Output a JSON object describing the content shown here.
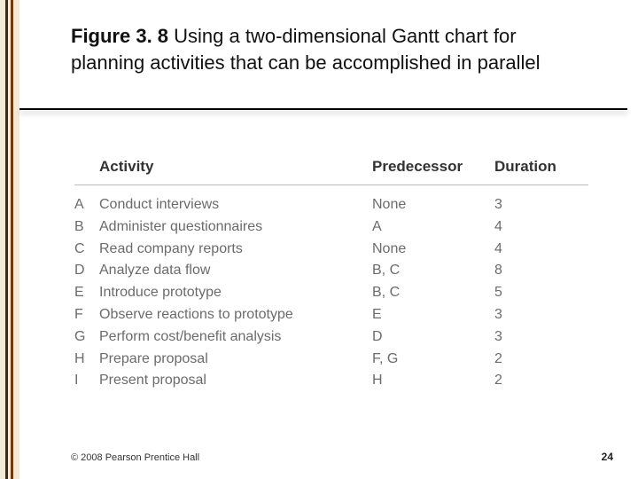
{
  "title": {
    "figure_label": "Figure 3. 8",
    "rest": " Using a two-dimensional Gantt chart for planning activities that can be accomplished in parallel"
  },
  "table": {
    "headers": {
      "activity": "Activity",
      "predecessor": "Predecessor",
      "duration": "Duration"
    },
    "rows": [
      {
        "key": "A",
        "activity": "Conduct interviews",
        "predecessor": "None",
        "duration": "3"
      },
      {
        "key": "B",
        "activity": "Administer questionnaires",
        "predecessor": "A",
        "duration": "4"
      },
      {
        "key": "C",
        "activity": "Read company reports",
        "predecessor": "None",
        "duration": "4"
      },
      {
        "key": "D",
        "activity": "Analyze data flow",
        "predecessor": "B, C",
        "duration": "8"
      },
      {
        "key": "E",
        "activity": "Introduce prototype",
        "predecessor": "B, C",
        "duration": "5"
      },
      {
        "key": "F",
        "activity": "Observe reactions to prototype",
        "predecessor": "E",
        "duration": "3"
      },
      {
        "key": "G",
        "activity": "Perform cost/benefit analysis",
        "predecessor": "D",
        "duration": "3"
      },
      {
        "key": "H",
        "activity": "Prepare proposal",
        "predecessor": "F, G",
        "duration": "2"
      },
      {
        "key": "I",
        "activity": "Present proposal",
        "predecessor": "H",
        "duration": "2"
      }
    ]
  },
  "footer": {
    "copyright": "© 2008 Pearson Prentice Hall",
    "page": "24"
  }
}
